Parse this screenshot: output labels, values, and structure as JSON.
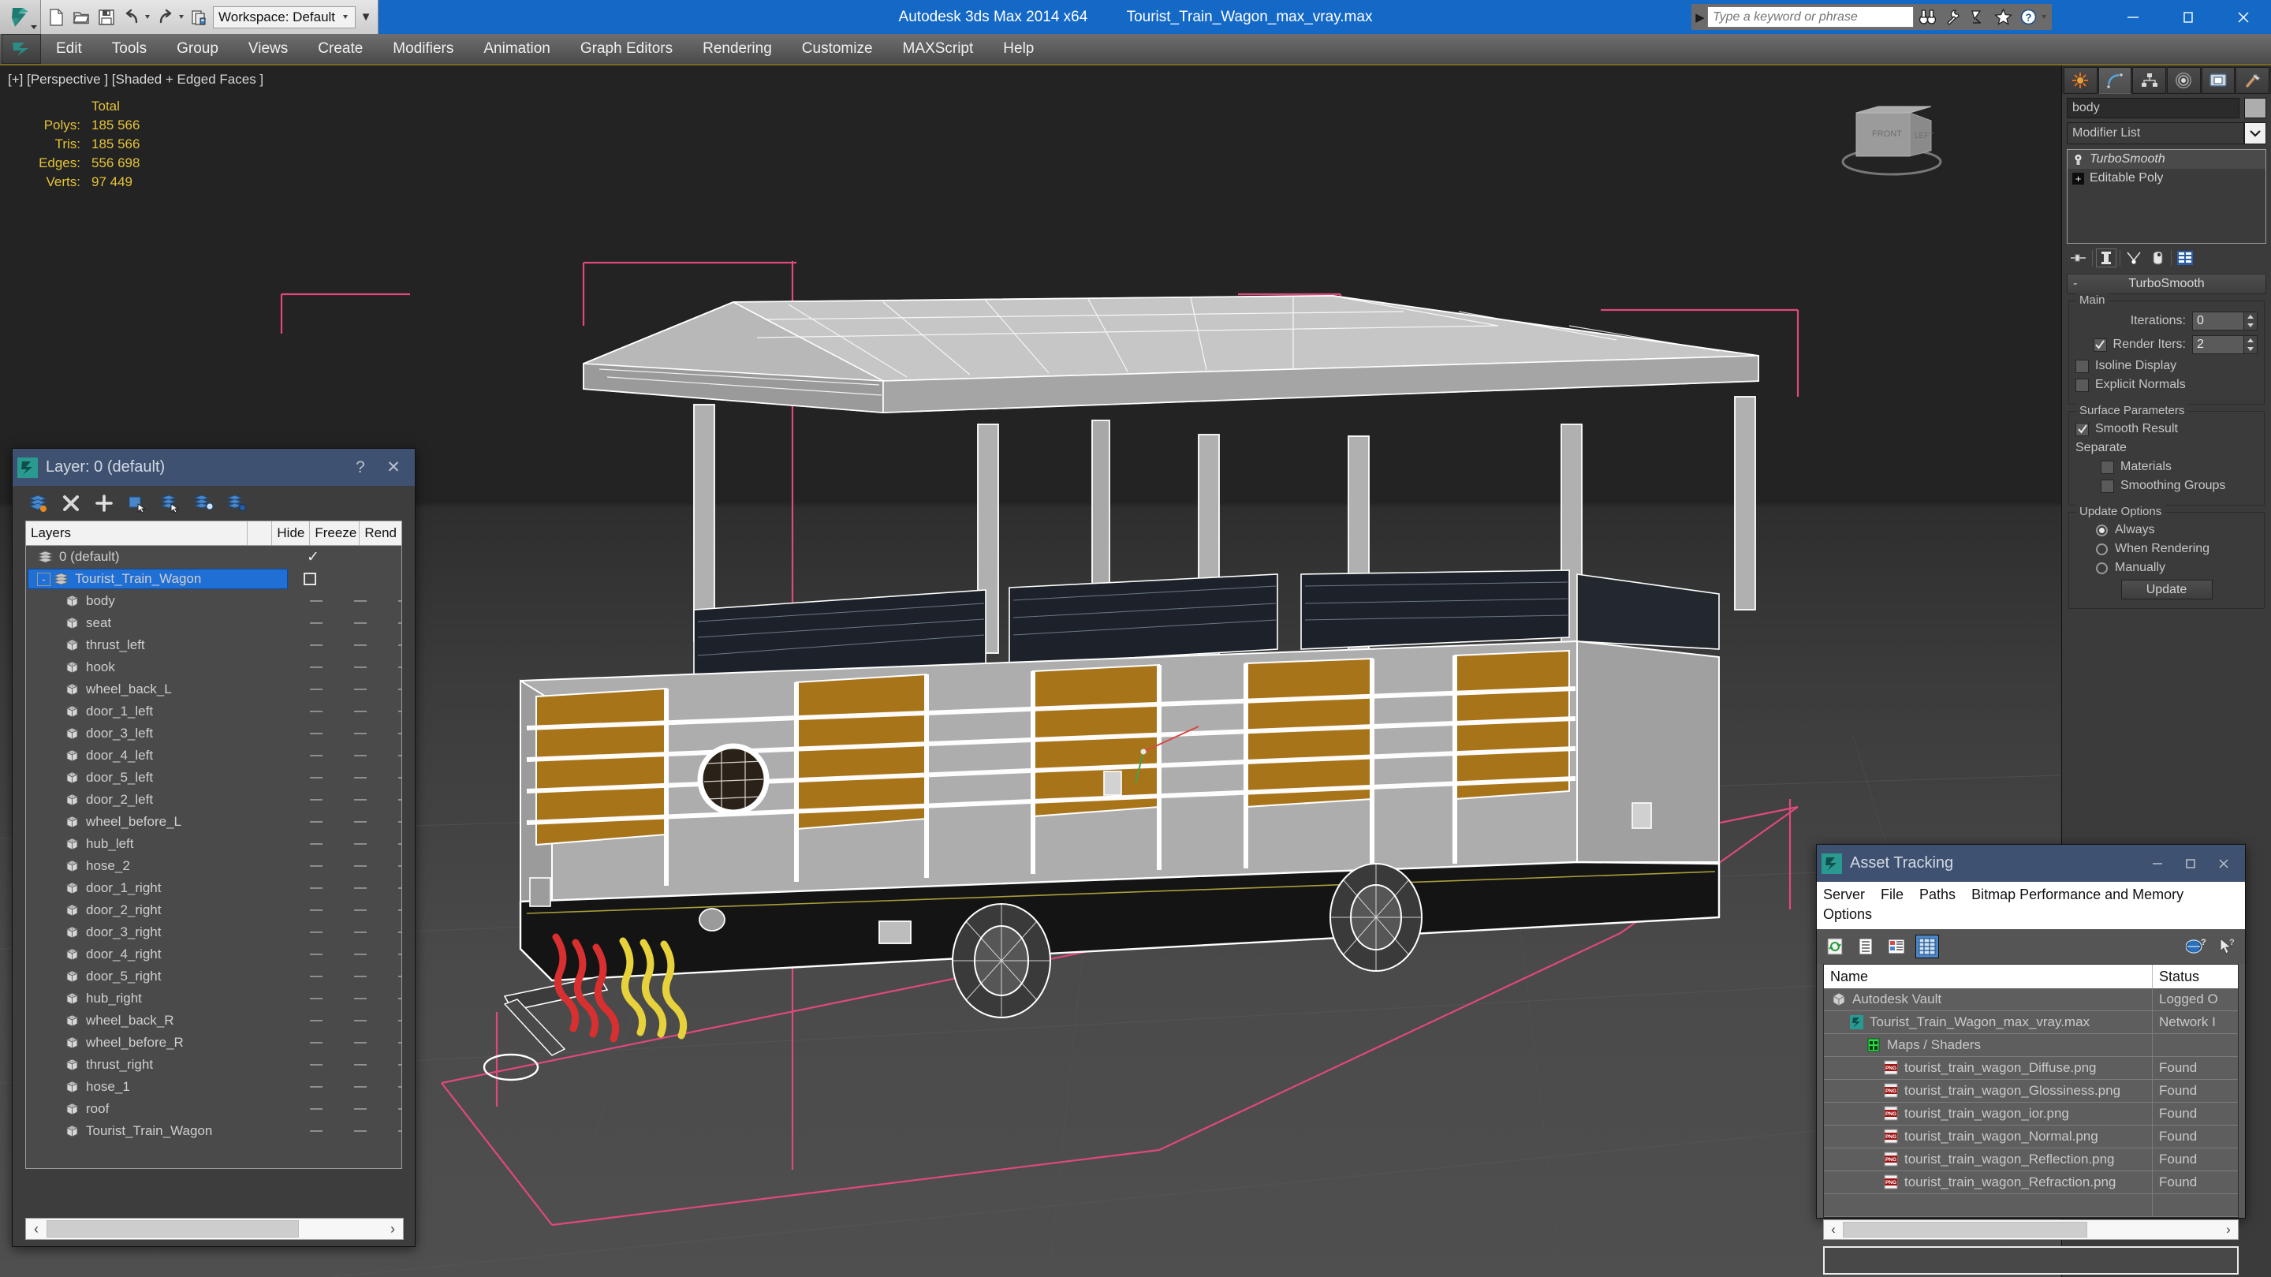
{
  "titlebar": {
    "workspace_label": "Workspace: Default",
    "app_title": "Autodesk 3ds Max  2014 x64",
    "file_title": "Tourist_Train_Wagon_max_vray.max",
    "search_placeholder": "Type a keyword or phrase",
    "quick_access": [
      "new-icon",
      "open-icon",
      "save-icon",
      "undo-icon",
      "redo-icon",
      "project-folder-icon"
    ],
    "search_icons": [
      "binoculars-icon",
      "wrench-icon",
      "satellite-icon",
      "star-icon",
      "help-icon"
    ],
    "window_buttons": [
      "minimize-icon",
      "maximize-icon",
      "close-icon"
    ]
  },
  "menubar": {
    "items": [
      "Edit",
      "Tools",
      "Group",
      "Views",
      "Create",
      "Modifiers",
      "Animation",
      "Graph Editors",
      "Rendering",
      "Customize",
      "MAXScript",
      "Help"
    ]
  },
  "viewport": {
    "label": "[+] [Perspective ] [Shaded + Edged Faces ]",
    "stats_header": "Total",
    "stats": [
      {
        "key": "Polys:",
        "value": "185 566"
      },
      {
        "key": "Tris:",
        "value": "185 566"
      },
      {
        "key": "Edges:",
        "value": "556 698"
      },
      {
        "key": "Verts:",
        "value": "97 449"
      }
    ],
    "viewcube_faces": [
      "FRONT",
      "LEFT"
    ],
    "model_colors": {
      "body_gray": "#adadad",
      "panel_orange": "#a8741a",
      "seat_dark": "#1d222a",
      "chassis_black": "#141414",
      "wire_white": "#ffffff",
      "gizmo_pink": "#e0487e",
      "hose_red": "#d83030",
      "hose_yellow": "#e8d23c"
    }
  },
  "command_panel": {
    "tabs": [
      "create-icon",
      "modify-icon",
      "hierarchy-icon",
      "motion-icon",
      "display-icon",
      "utilities-icon"
    ],
    "active_tab_index": 1,
    "object_name": "body",
    "modifier_list_label": "Modifier List",
    "stack": [
      {
        "name": "TurboSmooth",
        "italic": true,
        "selected": true
      },
      {
        "name": "Editable Poly",
        "italic": false,
        "selected": false
      }
    ],
    "stack_tools": [
      "pin-stack-icon",
      "show-end-result-icon",
      "make-unique-icon",
      "remove-modifier-icon",
      "configure-sets-icon"
    ],
    "rollout": {
      "title": "TurboSmooth",
      "collapse_sign": "-",
      "groups": [
        {
          "title": "Main",
          "iterations_label": "Iterations:",
          "iterations_value": "0",
          "render_iters_label": "Render Iters:",
          "render_iters_value": "2",
          "render_iters_checked": true,
          "isoline_label": "Isoline Display",
          "isoline_checked": false,
          "explicit_label": "Explicit Normals",
          "explicit_checked": false
        },
        {
          "title": "Surface Parameters",
          "smooth_result_label": "Smooth Result",
          "smooth_result_checked": true,
          "separate_label": "Separate",
          "materials_label": "Materials",
          "materials_checked": false,
          "smoothing_groups_label": "Smoothing Groups",
          "smoothing_groups_checked": false
        },
        {
          "title": "Update Options",
          "options": [
            "Always",
            "When Rendering",
            "Manually"
          ],
          "selected_option": 0,
          "update_button": "Update"
        }
      ]
    }
  },
  "layer_dialog": {
    "title": "Layer: 0 (default)",
    "help_label": "?",
    "close_label": "✕",
    "toolbar_icons": [
      "layer-set-current-icon",
      "delete-layer-icon",
      "new-layer-icon",
      "add-selection-to-layer-icon",
      "select-objects-in-layer-icon",
      "highlight-selected-objects-icon",
      "layer-properties-icon"
    ],
    "columns": [
      "Layers",
      "",
      "Hide",
      "Freeze",
      "Rend"
    ],
    "rows": [
      {
        "name": "0 (default)",
        "indent": 0,
        "icon": "layer-icon",
        "mark": "check",
        "expand": null,
        "selected": false
      },
      {
        "name": "Tourist_Train_Wagon",
        "indent": 0,
        "icon": "layer-icon",
        "mark": "square",
        "expand": "-",
        "selected": true
      },
      {
        "name": "body",
        "indent": 1,
        "icon": "object-icon",
        "mark": "dashes",
        "expand": null,
        "selected": false
      },
      {
        "name": "seat",
        "indent": 1,
        "icon": "object-icon",
        "mark": "dashes",
        "expand": null,
        "selected": false
      },
      {
        "name": "thrust_left",
        "indent": 1,
        "icon": "object-icon",
        "mark": "dashes",
        "expand": null,
        "selected": false
      },
      {
        "name": "hook",
        "indent": 1,
        "icon": "object-icon",
        "mark": "dashes",
        "expand": null,
        "selected": false
      },
      {
        "name": "wheel_back_L",
        "indent": 1,
        "icon": "object-icon",
        "mark": "dashes",
        "expand": null,
        "selected": false
      },
      {
        "name": "door_1_left",
        "indent": 1,
        "icon": "object-icon",
        "mark": "dashes",
        "expand": null,
        "selected": false
      },
      {
        "name": "door_3_left",
        "indent": 1,
        "icon": "object-icon",
        "mark": "dashes",
        "expand": null,
        "selected": false
      },
      {
        "name": "door_4_left",
        "indent": 1,
        "icon": "object-icon",
        "mark": "dashes",
        "expand": null,
        "selected": false
      },
      {
        "name": "door_5_left",
        "indent": 1,
        "icon": "object-icon",
        "mark": "dashes",
        "expand": null,
        "selected": false
      },
      {
        "name": "door_2_left",
        "indent": 1,
        "icon": "object-icon",
        "mark": "dashes",
        "expand": null,
        "selected": false
      },
      {
        "name": "wheel_before_L",
        "indent": 1,
        "icon": "object-icon",
        "mark": "dashes",
        "expand": null,
        "selected": false
      },
      {
        "name": "hub_left",
        "indent": 1,
        "icon": "object-icon",
        "mark": "dashes",
        "expand": null,
        "selected": false
      },
      {
        "name": "hose_2",
        "indent": 1,
        "icon": "object-icon",
        "mark": "dashes",
        "expand": null,
        "selected": false
      },
      {
        "name": "door_1_right",
        "indent": 1,
        "icon": "object-icon",
        "mark": "dashes",
        "expand": null,
        "selected": false
      },
      {
        "name": "door_2_right",
        "indent": 1,
        "icon": "object-icon",
        "mark": "dashes",
        "expand": null,
        "selected": false
      },
      {
        "name": "door_3_right",
        "indent": 1,
        "icon": "object-icon",
        "mark": "dashes",
        "expand": null,
        "selected": false
      },
      {
        "name": "door_4_right",
        "indent": 1,
        "icon": "object-icon",
        "mark": "dashes",
        "expand": null,
        "selected": false
      },
      {
        "name": "door_5_right",
        "indent": 1,
        "icon": "object-icon",
        "mark": "dashes",
        "expand": null,
        "selected": false
      },
      {
        "name": "hub_right",
        "indent": 1,
        "icon": "object-icon",
        "mark": "dashes",
        "expand": null,
        "selected": false
      },
      {
        "name": "wheel_back_R",
        "indent": 1,
        "icon": "object-icon",
        "mark": "dashes",
        "expand": null,
        "selected": false
      },
      {
        "name": "wheel_before_R",
        "indent": 1,
        "icon": "object-icon",
        "mark": "dashes",
        "expand": null,
        "selected": false
      },
      {
        "name": "thrust_right",
        "indent": 1,
        "icon": "object-icon",
        "mark": "dashes",
        "expand": null,
        "selected": false
      },
      {
        "name": "hose_1",
        "indent": 1,
        "icon": "object-icon",
        "mark": "dashes",
        "expand": null,
        "selected": false
      },
      {
        "name": "roof",
        "indent": 1,
        "icon": "object-icon",
        "mark": "dashes",
        "expand": null,
        "selected": false
      },
      {
        "name": "Tourist_Train_Wagon",
        "indent": 1,
        "icon": "object-icon",
        "mark": "dashes",
        "expand": null,
        "selected": false
      }
    ],
    "scroll_left": "‹",
    "scroll_right": "›"
  },
  "asset_tracking": {
    "title": "Asset Tracking",
    "window_buttons": [
      "minimize-icon",
      "maximize-icon",
      "close-icon"
    ],
    "menu": [
      "Server",
      "File",
      "Paths",
      "Bitmap Performance and Memory",
      "Options"
    ],
    "toolbar_icons": [
      "refresh-icon",
      "list-view-icon",
      "detail-view-icon",
      "grid-view-icon"
    ],
    "help_icons": [
      "web-help-icon",
      "context-help-icon"
    ],
    "columns": [
      "Name",
      "Status"
    ],
    "rows": [
      {
        "name": "Autodesk Vault",
        "status": "Logged O",
        "indent": 0,
        "icon": "vault-icon"
      },
      {
        "name": "Tourist_Train_Wagon_max_vray.max",
        "status": "Network I",
        "indent": 1,
        "icon": "max-file-icon"
      },
      {
        "name": "Maps / Shaders",
        "status": "",
        "indent": 2,
        "icon": "maps-icon"
      },
      {
        "name": "tourist_train_wagon_Diffuse.png",
        "status": "Found",
        "indent": 3,
        "icon": "png-icon"
      },
      {
        "name": "tourist_train_wagon_Glossiness.png",
        "status": "Found",
        "indent": 3,
        "icon": "png-icon"
      },
      {
        "name": "tourist_train_wagon_ior.png",
        "status": "Found",
        "indent": 3,
        "icon": "png-icon"
      },
      {
        "name": "tourist_train_wagon_Normal.png",
        "status": "Found",
        "indent": 3,
        "icon": "png-icon"
      },
      {
        "name": "tourist_train_wagon_Reflection.png",
        "status": "Found",
        "indent": 3,
        "icon": "png-icon"
      },
      {
        "name": "tourist_train_wagon_Refraction.png",
        "status": "Found",
        "indent": 3,
        "icon": "png-icon"
      },
      {
        "name": "",
        "status": "",
        "indent": 0,
        "icon": "none"
      }
    ],
    "scroll_left": "‹",
    "scroll_right": "›"
  }
}
